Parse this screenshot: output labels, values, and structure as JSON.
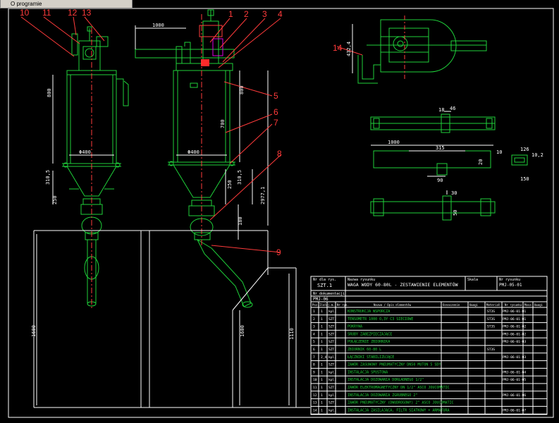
{
  "menu": {
    "label": "O programie"
  },
  "callouts": [
    "10",
    "11",
    "12",
    "13",
    "1",
    "2",
    "3",
    "4",
    "5",
    "6",
    "7",
    "8",
    "9",
    "14"
  ],
  "dimensions": {
    "left_height": "800",
    "left_dia": "Φ400",
    "left_cone": "310,5",
    "left_cone2": "250",
    "left_base": "1600",
    "center_width": "1000",
    "center_height": "800",
    "center_dia": "Φ400",
    "center_mid": "700",
    "center_cone": "250",
    "center_cone2": "310,5",
    "center_total": "2977,1",
    "center_bottom": "180",
    "center_base": "1600",
    "right_base": "1110",
    "top_dim": "432,4",
    "bar_18": "18",
    "bar_46": "46",
    "bar_1000": "1000",
    "bar_315": "315",
    "bar_10": "10",
    "bar_20": "20",
    "bar_90": "90",
    "bar_50": "50",
    "bar_126": "126",
    "bar_150": "150",
    "bar_102": "10,2",
    "bar_30": "30"
  },
  "title_block": {
    "label_symbol": "Nr dla rys.",
    "symbol": "SZT.1",
    "label_name": "Nazwa rysunku",
    "name": "WAGA WODY 60-80L - ZESTAWIENIE ELEMENTÓW",
    "label_scale": "Skala",
    "label_drawing_no": "Nr rysunku",
    "drawing_no": "PMJ-05-01",
    "label_assembly": "Nr dokumentacji",
    "assembly_no": "PMJ-06"
  },
  "table_header": [
    "Poz.",
    "Ilość",
    "j.m.",
    "Nr rys.",
    "Nazwa / Opis elementów",
    "Oznaczenie",
    "Uwagi",
    "Materiał",
    "Nr rysunku",
    "Masa",
    "Uwagi"
  ],
  "rows": [
    {
      "pos": "1",
      "qty": "1",
      "unit": "kpl.",
      "code": "",
      "desc": "KONSTRUKCJA WSPORCZA",
      "mat": "ST3S",
      "draw": "PMJ-06-01-01"
    },
    {
      "pos": "2",
      "qty": "1",
      "unit": "SZT.",
      "code": "",
      "desc": "TENSOMETR 1000 O,3Y C3 SIECIOWE",
      "mat": "ST3S",
      "draw": "PMJ-06-01-01"
    },
    {
      "pos": "3",
      "qty": "1",
      "unit": "SZT.",
      "code": "",
      "desc": "POKRYWA",
      "mat": "ST3S",
      "draw": "PMJ-06-01-02"
    },
    {
      "pos": "4",
      "qty": "1",
      "unit": "SZT.",
      "code": "",
      "desc": "ŚRUBY ZABEZPIECZAJĄCE",
      "mat": "",
      "draw": "PMJ-06-01-02"
    },
    {
      "pos": "5",
      "qty": "1",
      "unit": "SZT.",
      "code": "",
      "desc": "POŁĄCZENIE ZBIORNIKA",
      "mat": "",
      "draw": "PMJ-06-01-03"
    },
    {
      "pos": "6",
      "qty": "1",
      "unit": "SZT.",
      "code": "",
      "desc": "ZBIORNIK 60-80 L",
      "mat": "ST3S",
      "draw": ""
    },
    {
      "pos": "7",
      "qty": "2_4",
      "unit": "kpl.",
      "code": "",
      "desc": "ŁĄCZNIKI STABILIZUJĄCE",
      "mat": "",
      "draw": "PMJ-06-01-03"
    },
    {
      "pos": "8",
      "qty": "1",
      "unit": "SZT.",
      "code": "",
      "desc": "ZAWÓR ZASUWOWY PNEUMATYCZNY DN50 MUTON 5 SDY",
      "mat": "",
      "draw": ""
    },
    {
      "pos": "9",
      "qty": "1",
      "unit": "kpl.",
      "code": "",
      "desc": "INSTALACJA SPUSTOWA",
      "mat": "",
      "draw": "PMJ-06-01-04"
    },
    {
      "pos": "10",
      "qty": "1",
      "unit": "kpl.",
      "code": "",
      "desc": "INSTALACJA DOZOWANIA DOKŁADNEGO 1/2\"",
      "mat": "",
      "draw": "PMJ-06-01-05"
    },
    {
      "pos": "11",
      "qty": "1",
      "unit": "SZT.",
      "code": "",
      "desc": "ZAWÓR ELEKTROMAGNETYCZNY DN 1/2\" ASCO JOUCOMATIC",
      "mat": "",
      "draw": ""
    },
    {
      "pos": "12",
      "qty": "1",
      "unit": "kpl.",
      "code": "",
      "desc": "INSTALACJA DOZOWANIA ZGRUBNEGO 2\"",
      "mat": "",
      "draw": "PMJ-06-01-06"
    },
    {
      "pos": "13",
      "qty": "1",
      "unit": "SZT.",
      "code": "",
      "desc": "ZAWÓR PNEUMATYCZNY (DWUDROGOWY) 2\" ASCO JOUCOMATIC",
      "mat": "",
      "draw": ""
    },
    {
      "pos": "14",
      "qty": "1",
      "unit": "kpl.",
      "code": "",
      "desc": "INSTALACJA ZASILAJĄCA, FILTR SIATKOWY + ARMATURA",
      "mat": "",
      "draw": "PMJ-06-01-07"
    }
  ]
}
